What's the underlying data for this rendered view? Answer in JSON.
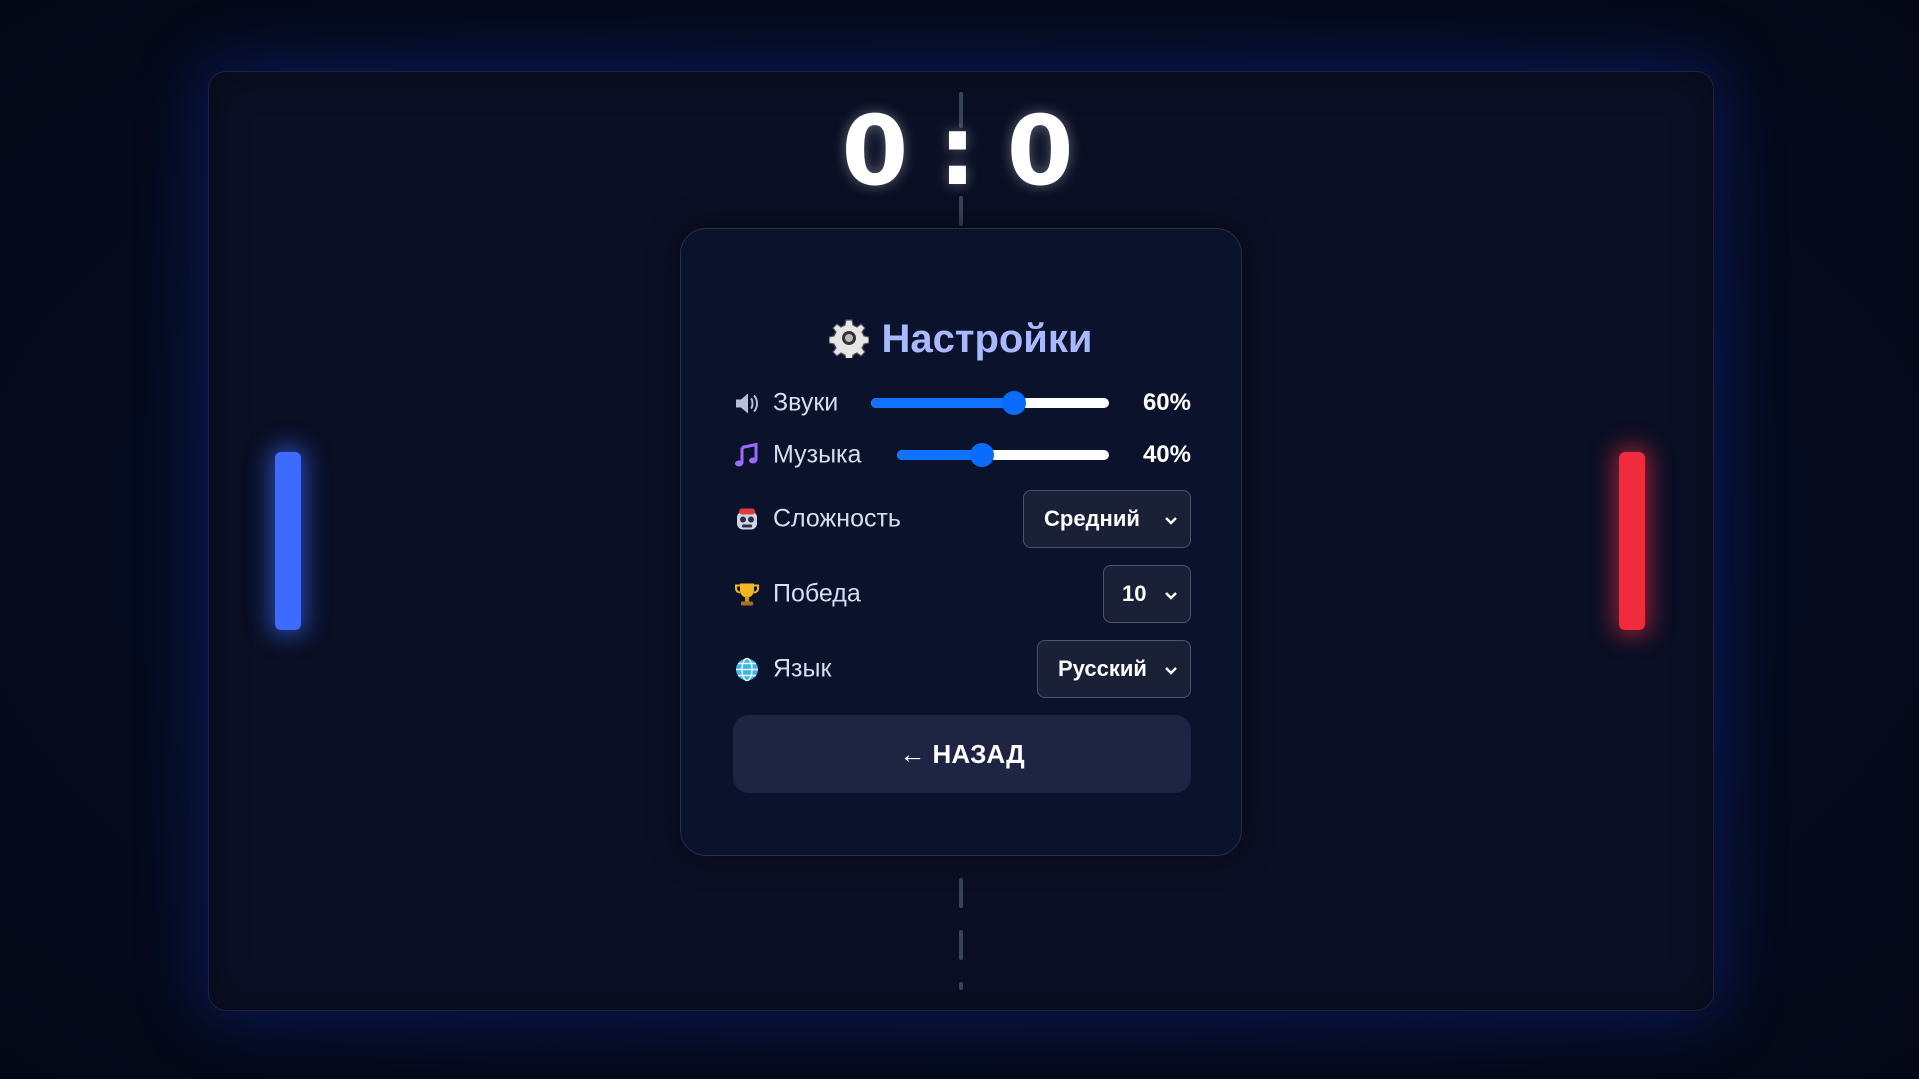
{
  "score": {
    "left": "0",
    "separator": ":",
    "right": "0"
  },
  "colors": {
    "left_paddle": "#3d6bff",
    "right_paddle": "#ef2b3c",
    "accent": "#1072ff",
    "title": "#a9b8ff"
  },
  "settings": {
    "title": "Настройки",
    "sound": {
      "label": "Звуки",
      "value": 60,
      "display": "60%",
      "icon": "speaker-icon"
    },
    "music": {
      "label": "Музыка",
      "value": 40,
      "display": "40%",
      "icon": "music-note-icon"
    },
    "difficulty": {
      "label": "Сложность",
      "selected": "Средний",
      "icon": "robot-icon"
    },
    "win": {
      "label": "Победа",
      "selected": "10",
      "icon": "trophy-icon"
    },
    "language": {
      "label": "Язык",
      "selected": "Русский",
      "icon": "globe-icon"
    },
    "back_label": "← НАЗАД"
  }
}
